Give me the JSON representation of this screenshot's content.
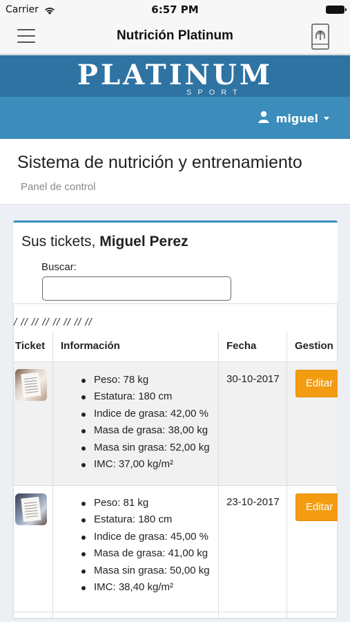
{
  "status_bar": {
    "carrier": "Carrier",
    "time": "6:57 PM"
  },
  "nav": {
    "title": "Nutrición Platinum"
  },
  "brand": {
    "logo_text": "PLATINUM",
    "logo_sub": "SPORT"
  },
  "user_menu": {
    "username": "miguel"
  },
  "header": {
    "title": "Sistema de nutrición y entrenamiento",
    "breadcrumb": "Panel de control"
  },
  "tickets": {
    "title_prefix": "Sus tickets, ",
    "user_full_name": "Miguel Perez",
    "search_label": "Buscar:",
    "search_value": "",
    "pagination_text": "/ // // // // // // //",
    "columns": [
      "Ticket",
      "Información",
      "Fecha",
      "Gestion"
    ],
    "rows": [
      {
        "info": [
          "Peso: 78 kg",
          "Estatura: 180 cm",
          "Indice de grasa: 42,00 %",
          "Masa de grasa: 38,00 kg",
          "Masa sin grasa: 52,00 kg",
          "IMC: 37,00 kg/m²"
        ],
        "date": "30-10-2017",
        "action": "Editar"
      },
      {
        "info": [
          "Peso: 81 kg",
          "Estatura: 180 cm",
          "Indice de grasa: 45,00 %",
          "Masa de grasa: 41,00 kg",
          "Masa sin grasa: 50,00 kg",
          "IMC: 38,40 kg/m²"
        ],
        "date": "23-10-2017",
        "action": "Editar"
      }
    ]
  },
  "colors": {
    "brand": "#2f73a3",
    "userbar": "#3c8dbc",
    "edit_button": "#f39c12",
    "row_shade": "#f1f1f2"
  },
  "icons": [
    "wifi-icon",
    "battery-icon",
    "hamburger-menu-icon",
    "upload-icon",
    "user-icon",
    "caret-down-icon"
  ]
}
